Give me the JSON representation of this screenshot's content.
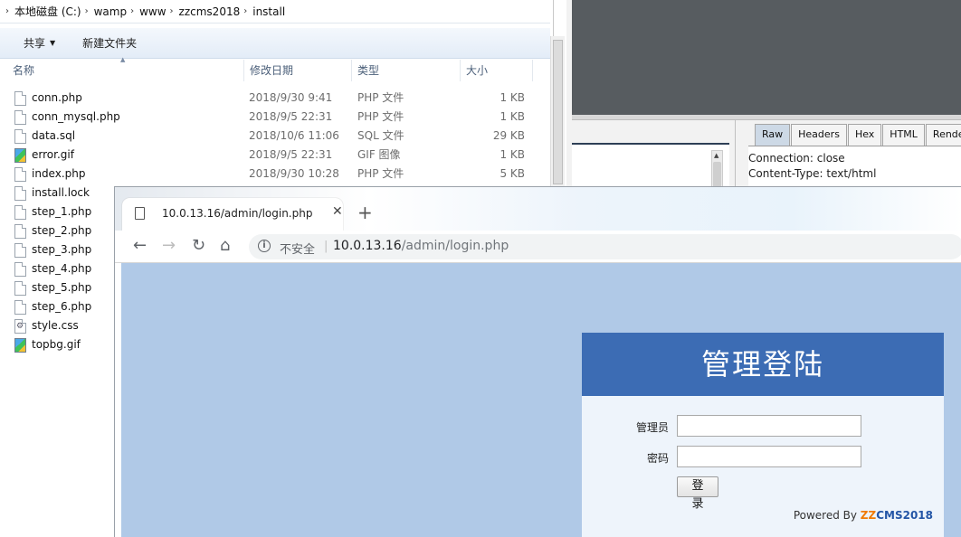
{
  "explorer": {
    "breadcrumb": [
      "本地磁盘 (C:)",
      "wamp",
      "www",
      "zzcms2018",
      "install"
    ],
    "toolbar": {
      "share_label": "共享",
      "new_folder_label": "新建文件夹"
    },
    "columns": {
      "name": "名称",
      "date": "修改日期",
      "type": "类型",
      "size": "大小"
    },
    "files": [
      {
        "name": "conn.php",
        "date": "2018/9/30 9:41",
        "type": "PHP 文件",
        "size": "1 KB",
        "icon": "file-icon"
      },
      {
        "name": "conn_mysql.php",
        "date": "2018/9/5 22:31",
        "type": "PHP 文件",
        "size": "1 KB",
        "icon": "file-icon"
      },
      {
        "name": "data.sql",
        "date": "2018/10/6 11:06",
        "type": "SQL 文件",
        "size": "29 KB",
        "icon": "file-icon"
      },
      {
        "name": "error.gif",
        "date": "2018/9/5 22:31",
        "type": "GIF 图像",
        "size": "1 KB",
        "icon": "image-icon"
      },
      {
        "name": "index.php",
        "date": "2018/9/30 10:28",
        "type": "PHP 文件",
        "size": "5 KB",
        "icon": "file-icon"
      },
      {
        "name": "install.lock",
        "date": "",
        "type": "",
        "size": "",
        "icon": "file-icon"
      },
      {
        "name": "step_1.php",
        "date": "",
        "type": "",
        "size": "",
        "icon": "file-icon"
      },
      {
        "name": "step_2.php",
        "date": "",
        "type": "",
        "size": "",
        "icon": "file-icon"
      },
      {
        "name": "step_3.php",
        "date": "",
        "type": "",
        "size": "",
        "icon": "file-icon"
      },
      {
        "name": "step_4.php",
        "date": "",
        "type": "",
        "size": "",
        "icon": "file-icon"
      },
      {
        "name": "step_5.php",
        "date": "",
        "type": "",
        "size": "",
        "icon": "file-icon"
      },
      {
        "name": "step_6.php",
        "date": "",
        "type": "",
        "size": "",
        "icon": "file-icon"
      },
      {
        "name": "style.css",
        "date": "",
        "type": "",
        "size": "",
        "icon": "css-icon"
      },
      {
        "name": "topbg.gif",
        "date": "",
        "type": "",
        "size": "",
        "icon": "image-icon"
      }
    ]
  },
  "proxy": {
    "tabs": [
      "Raw",
      "Headers",
      "Hex",
      "HTML",
      "Render"
    ],
    "active_tab": "Raw",
    "response_lines": [
      "Connection: close",
      "Content-Type: text/html"
    ]
  },
  "browser": {
    "tab_title": "10.0.13.16/admin/login.php",
    "insecure_label": "不安全",
    "url_host": "10.0.13.16",
    "url_path": "/admin/login.php",
    "background_color": "#b0c9e7"
  },
  "login": {
    "title": "管理登陆",
    "admin_label": "管理员",
    "password_label": "密码",
    "submit_label": "登 录",
    "powered_prefix": "Powered By ",
    "brand_zz": "ZZ",
    "brand_rest": "CMS2018",
    "header_color": "#3c6cb4"
  }
}
